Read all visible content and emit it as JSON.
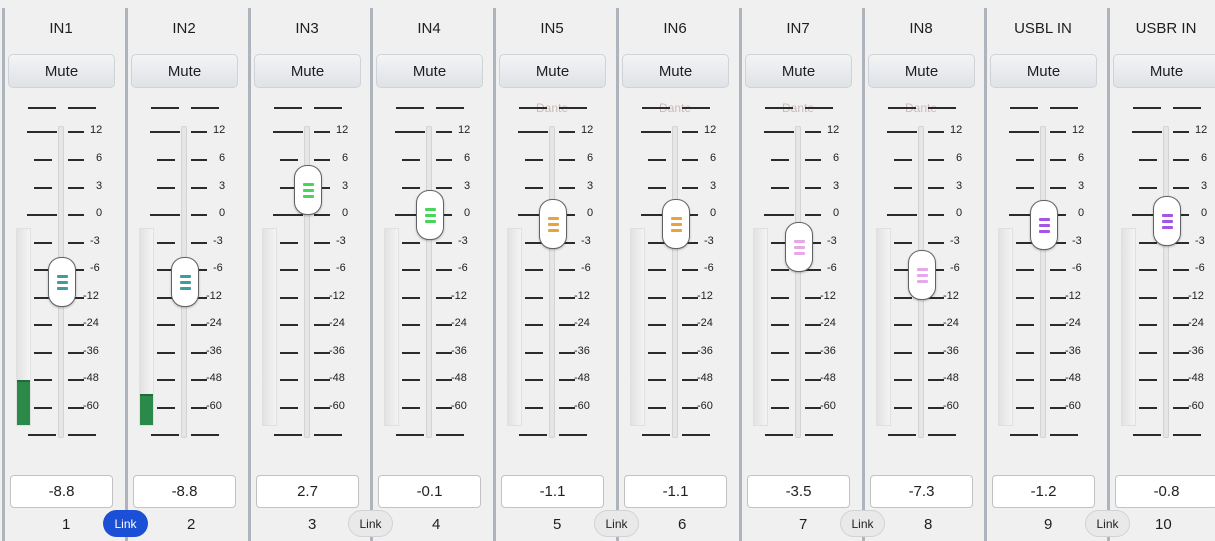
{
  "channels": [
    {
      "name": "IN1",
      "mute": "Mute",
      "dante": "",
      "value": "-8.8",
      "number": "1",
      "knob_db": -8.8,
      "knob_color": "#3f9c9b",
      "meter_level": 0.22,
      "meter_color": "#2b8a4a"
    },
    {
      "name": "IN2",
      "mute": "Mute",
      "dante": "",
      "value": "-8.8",
      "number": "2",
      "knob_db": -8.8,
      "knob_color": "#3f9c9b",
      "meter_level": 0.15,
      "meter_color": "#2b8a4a"
    },
    {
      "name": "IN3",
      "mute": "Mute",
      "dante": "",
      "value": "2.7",
      "number": "3",
      "knob_db": 2.7,
      "knob_color": "#49d45a",
      "meter_level": 0,
      "meter_color": "#2b8a4a"
    },
    {
      "name": "IN4",
      "mute": "Mute",
      "dante": "",
      "value": "-0.1",
      "number": "4",
      "knob_db": -0.1,
      "knob_color": "#49d45a",
      "meter_level": 0,
      "meter_color": "#2b8a4a"
    },
    {
      "name": "IN5",
      "mute": "Mute",
      "dante": "Dante",
      "value": "-1.1",
      "number": "5",
      "knob_db": -1.1,
      "knob_color": "#e8a33c",
      "meter_level": 0,
      "meter_color": "#2b8a4a"
    },
    {
      "name": "IN6",
      "mute": "Mute",
      "dante": "Dante",
      "value": "-1.1",
      "number": "6",
      "knob_db": -1.1,
      "knob_color": "#e8a33c",
      "meter_level": 0,
      "meter_color": "#2b8a4a"
    },
    {
      "name": "IN7",
      "mute": "Mute",
      "dante": "Dante",
      "value": "-3.5",
      "number": "7",
      "knob_db": -3.5,
      "knob_color": "#e6a8e8",
      "meter_level": 0,
      "meter_color": "#2b8a4a"
    },
    {
      "name": "IN8",
      "mute": "Mute",
      "dante": "Dante",
      "value": "-7.3",
      "number": "8",
      "knob_db": -7.3,
      "knob_color": "#e6a8e8",
      "meter_level": 0,
      "meter_color": "#2b8a4a"
    },
    {
      "name": "USBL IN",
      "mute": "Mute",
      "dante": "",
      "value": "-1.2",
      "number": "9",
      "knob_db": -1.2,
      "knob_color": "#a455e6",
      "meter_level": 0,
      "meter_color": "#2b8a4a"
    },
    {
      "name": "USBR IN",
      "mute": "Mute",
      "dante": "",
      "value": "-0.8",
      "number": "10",
      "knob_db": -0.8,
      "knob_color": "#a455e6",
      "meter_level": 0,
      "meter_color": "#2b8a4a"
    }
  ],
  "scale_labels": [
    "12",
    "6",
    "3",
    "0",
    "-3",
    "-6",
    "-12",
    "-24",
    "-36",
    "-48",
    "-60"
  ],
  "links": [
    {
      "label": "Link",
      "active": true
    },
    {
      "label": "Link",
      "active": false
    },
    {
      "label": "Link",
      "active": false
    },
    {
      "label": "Link",
      "active": false
    },
    {
      "label": "Link",
      "active": false
    }
  ]
}
